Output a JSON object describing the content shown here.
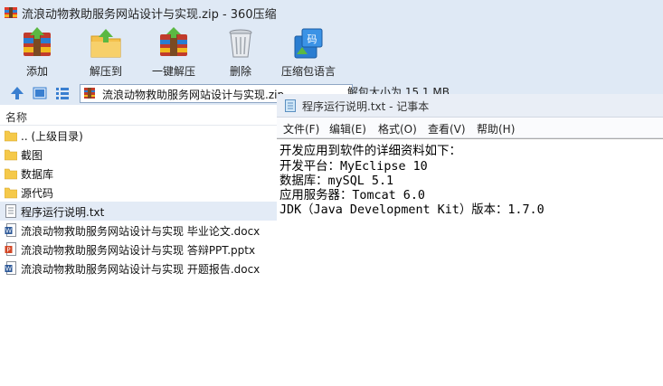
{
  "window": {
    "title": "流浪动物救助服务网站设计与实现.zip - 360压缩"
  },
  "toolbar": {
    "buttons": [
      {
        "label": "添加",
        "icon": "add-archive-icon"
      },
      {
        "label": "解压到",
        "icon": "extract-to-icon"
      },
      {
        "label": "一键解压",
        "icon": "one-click-extract-icon"
      },
      {
        "label": "删除",
        "icon": "delete-trash-icon"
      },
      {
        "label": "压缩包语言",
        "icon": "archive-language-icon"
      }
    ]
  },
  "addressbar": {
    "path": "流浪动物救助服务网站设计与实现.zip",
    "size_info": "解包大小为 15.1 MB"
  },
  "filelist": {
    "column_header": "名称",
    "rows": [
      {
        "name": ".. (上级目录)",
        "type": "folder"
      },
      {
        "name": "截图",
        "type": "folder"
      },
      {
        "name": "数据库",
        "type": "folder"
      },
      {
        "name": "源代码",
        "type": "folder"
      },
      {
        "name": "程序运行说明.txt",
        "type": "txt"
      },
      {
        "name": "流浪动物救助服务网站设计与实现 毕业论文.docx",
        "type": "docx"
      },
      {
        "name": "流浪动物救助服务网站设计与实现 答辩PPT.pptx",
        "type": "pptx"
      },
      {
        "name": "流浪动物救助服务网站设计与实现 开题报告.docx",
        "type": "docx"
      }
    ]
  },
  "notepad": {
    "title": "程序运行说明.txt - 记事本",
    "menu": [
      "文件(F)",
      "编辑(E)",
      "格式(O)",
      "查看(V)",
      "帮助(H)"
    ],
    "lines": [
      "开发应用到软件的详细资料如下：",
      "开发平台：MyEclipse 10",
      "数据库：mySQL 5.1",
      "应用服务器：Tomcat 6.0",
      "JDK（Java Development Kit）版本：1.7.0"
    ]
  },
  "colors": {
    "chrome_bg": "#dfe9f5",
    "selected_row": "#e3ebf6",
    "folder_yellow": "#f5c94a",
    "word_blue": "#2b5797",
    "ppt_orange": "#d24726"
  }
}
